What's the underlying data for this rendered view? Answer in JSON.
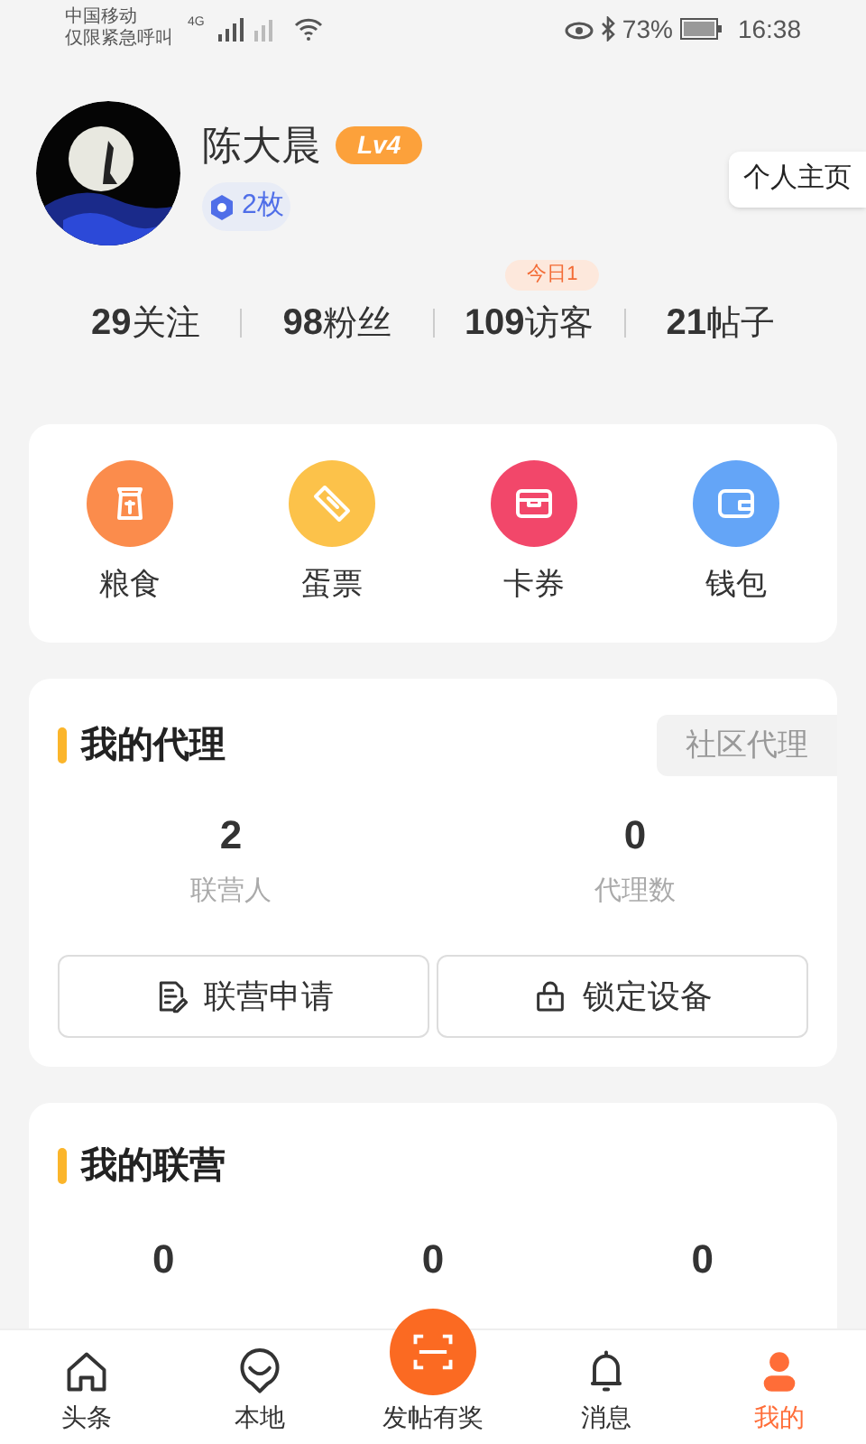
{
  "status_bar": {
    "carrier": "中国移动",
    "carrier_note": "仅限紧急呼叫",
    "network": "4G",
    "battery": "73%",
    "time": "16:38"
  },
  "profile": {
    "name": "陈大晨",
    "level": "Lv4",
    "medals": "2枚",
    "homepage_button": "个人主页"
  },
  "stats": [
    {
      "number": "29",
      "label": "关注"
    },
    {
      "number": "98",
      "label": "粉丝"
    },
    {
      "number": "109",
      "label": "访客",
      "badge": "今日1"
    },
    {
      "number": "21",
      "label": "帖子"
    }
  ],
  "shortcuts": [
    {
      "kind": "grain",
      "label": "粮食",
      "color": "#fb8c4c"
    },
    {
      "kind": "ticket",
      "label": "蛋票",
      "color": "#fcc24a"
    },
    {
      "kind": "card",
      "label": "卡券",
      "color": "#f2476a"
    },
    {
      "kind": "wallet",
      "label": "钱包",
      "color": "#64a5f7"
    }
  ],
  "agency": {
    "title": "我的代理",
    "link": "社区代理",
    "metrics": [
      {
        "value": "2",
        "label": "联营人"
      },
      {
        "value": "0",
        "label": "代理数"
      }
    ],
    "actions": [
      {
        "kind": "apply",
        "label": "联营申请"
      },
      {
        "kind": "lock",
        "label": "锁定设备"
      }
    ]
  },
  "joint": {
    "title": "我的联营",
    "metrics": [
      {
        "value": "0"
      },
      {
        "value": "0"
      },
      {
        "value": "0"
      }
    ]
  },
  "nav": [
    {
      "kind": "home",
      "label": "头条",
      "selected": false
    },
    {
      "kind": "pin",
      "label": "本地",
      "selected": false
    },
    {
      "kind": "scan",
      "label": "发帖有奖",
      "selected": false
    },
    {
      "kind": "bell",
      "label": "消息",
      "selected": false
    },
    {
      "kind": "person",
      "label": "我的",
      "selected": true
    }
  ]
}
